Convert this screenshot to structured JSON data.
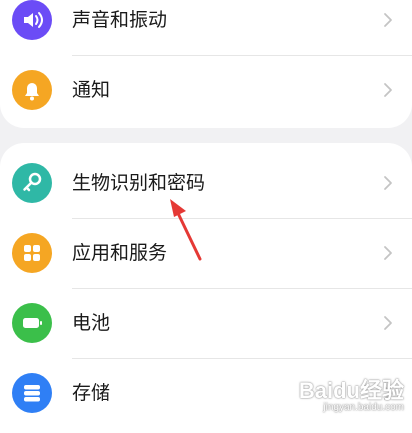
{
  "settings": {
    "group1": [
      {
        "id": "sound",
        "label": "声音和振动",
        "icon": "volume-icon",
        "color": "#6b4cf6"
      },
      {
        "id": "notify",
        "label": "通知",
        "icon": "bell-icon",
        "color": "#f5a623"
      }
    ],
    "group2": [
      {
        "id": "biometrics",
        "label": "生物识别和密码",
        "icon": "key-icon",
        "color": "#2fb8a6"
      },
      {
        "id": "apps",
        "label": "应用和服务",
        "icon": "apps-icon",
        "color": "#f5a623"
      },
      {
        "id": "battery",
        "label": "电池",
        "icon": "battery-icon",
        "color": "#3bbf4a"
      },
      {
        "id": "storage",
        "label": "存储",
        "icon": "storage-icon",
        "color": "#2f7ff5"
      }
    ]
  },
  "annotation": {
    "color": "#e53935"
  },
  "watermark": {
    "logo": "Baidu经验",
    "url": "jingyan.baidu.com"
  }
}
